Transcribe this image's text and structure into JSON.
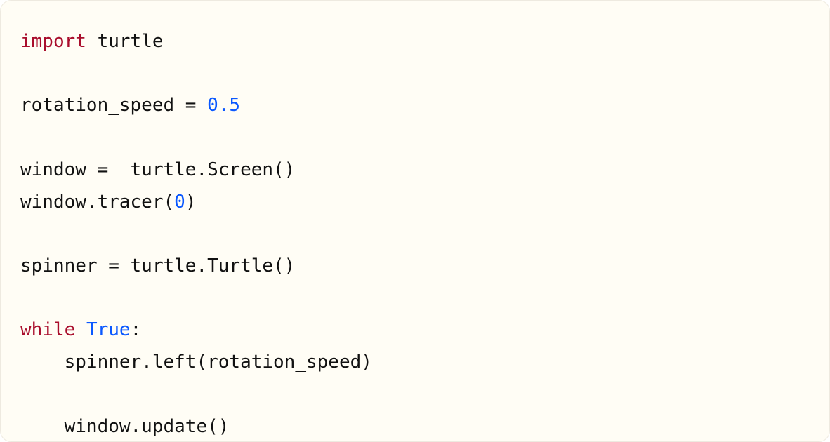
{
  "code": {
    "lines": [
      [
        {
          "t": "import",
          "c": "tok-kw"
        },
        {
          "t": " turtle",
          "c": ""
        }
      ],
      [],
      [
        {
          "t": "rotation_speed = ",
          "c": ""
        },
        {
          "t": "0.5",
          "c": "tok-num"
        }
      ],
      [],
      [
        {
          "t": "window =  turtle.Screen()",
          "c": ""
        }
      ],
      [
        {
          "t": "window.tracer(",
          "c": ""
        },
        {
          "t": "0",
          "c": "tok-num"
        },
        {
          "t": ")",
          "c": ""
        }
      ],
      [],
      [
        {
          "t": "spinner = turtle.Turtle()",
          "c": ""
        }
      ],
      [],
      [
        {
          "t": "while",
          "c": "tok-kw"
        },
        {
          "t": " ",
          "c": ""
        },
        {
          "t": "True",
          "c": "tok-const"
        },
        {
          "t": ":",
          "c": ""
        }
      ],
      [
        {
          "t": "    spinner.left(rotation_speed)",
          "c": ""
        }
      ],
      [],
      [
        {
          "t": "    window.update()",
          "c": ""
        }
      ]
    ]
  },
  "colors": {
    "background": "#fffdf5",
    "border": "#eeeae0",
    "text": "#111111",
    "keyword": "#a90d2c",
    "number": "#0a58ff",
    "constant": "#0a58ff"
  }
}
